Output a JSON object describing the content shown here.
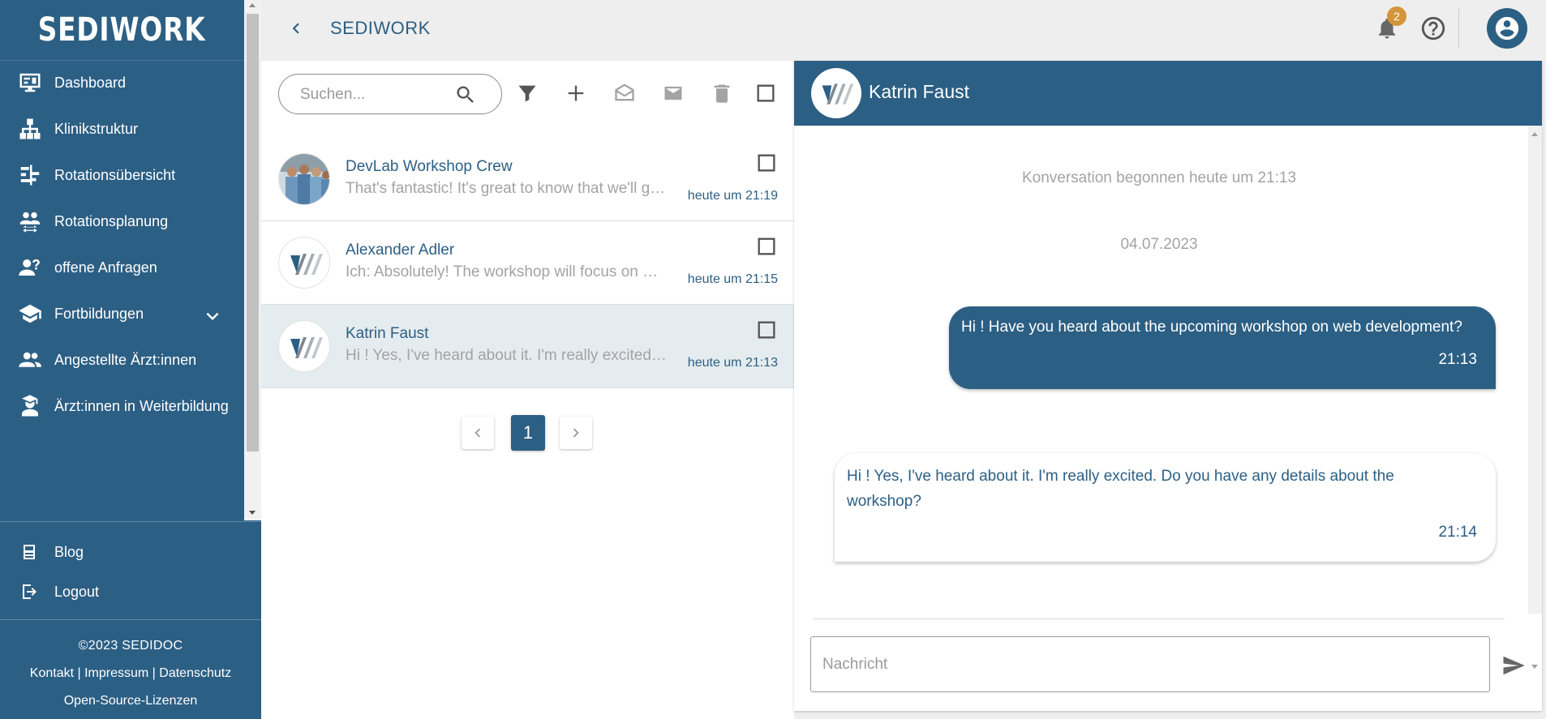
{
  "brand": {
    "logo": "SEDIWORK"
  },
  "sidebar": {
    "items": [
      {
        "label": "Dashboard",
        "icon": "dashboard-icon"
      },
      {
        "label": "Klinikstruktur",
        "icon": "sitemap-icon"
      },
      {
        "label": "Rotationsübersicht",
        "icon": "timeline-icon"
      },
      {
        "label": "Rotationsplanung",
        "icon": "rotation-icon"
      },
      {
        "label": "offene Anfragen",
        "icon": "person-question-icon"
      },
      {
        "label": "Fortbildungen",
        "icon": "school-icon",
        "expandable": true
      },
      {
        "label": "Angestellte Ärzt:innen",
        "icon": "people-icon"
      },
      {
        "label": "Ärzt:innen in Weiterbildung",
        "icon": "graduate-icon"
      }
    ],
    "bottom": [
      {
        "label": "Blog",
        "icon": "blog-icon"
      },
      {
        "label": "Logout",
        "icon": "logout-icon"
      }
    ],
    "copyright": "©2023 SEDIDOC",
    "footer_links": [
      "Kontakt",
      "Impressum",
      "Datenschutz"
    ],
    "footer_separator": " | ",
    "oss": "Open-Source-Lizenzen"
  },
  "topbar": {
    "title": "SEDIWORK",
    "notification_count": "2"
  },
  "list": {
    "search_placeholder": "Suchen...",
    "conversations": [
      {
        "name": "DevLab Workshop Crew",
        "preview": "That's fantastic! It's great to know that we'll get to...",
        "time": "heute um 21:19",
        "active": false
      },
      {
        "name": "Alexander Adler",
        "preview": "Ich: Absolutely! The workshop will focus on modern web...",
        "time": "heute um 21:15",
        "active": false
      },
      {
        "name": "Katrin Faust",
        "preview": "Hi ! Yes, I've heard about it. I'm really excited. Do you...",
        "time": "heute um 21:13",
        "active": true
      }
    ],
    "page": "1"
  },
  "chat": {
    "name": "Katrin Faust",
    "started": "Konversation begonnen heute um 21:13",
    "date": "04.07.2023",
    "messages": [
      {
        "direction": "out",
        "text": "Hi ! Have you heard about the upcoming workshop on web development?",
        "time": "21:13"
      },
      {
        "direction": "in",
        "text": "Hi ! Yes, I've heard about it. I'm really excited. Do you have any details about the workshop?",
        "time": "21:14"
      }
    ],
    "input_placeholder": "Nachricht"
  },
  "colors": {
    "primary": "#2c5f84",
    "badge": "#d4953a",
    "muted": "#a3a3a3"
  }
}
